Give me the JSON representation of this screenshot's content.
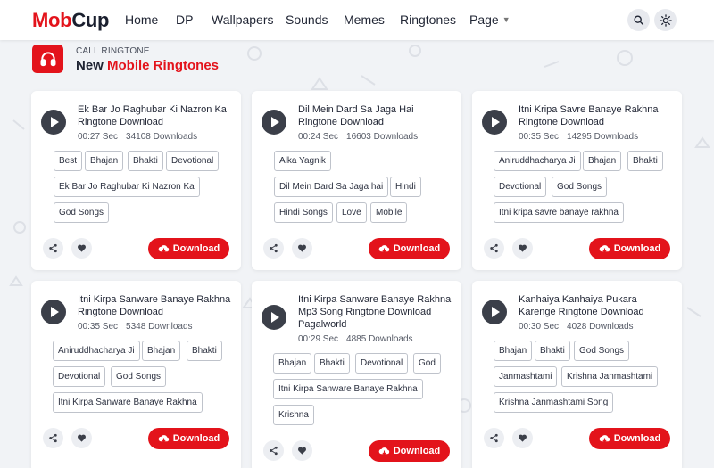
{
  "brand": {
    "part1": "Mob",
    "part2": "Cup"
  },
  "nav": [
    "Home",
    "DP",
    "Wallpapers",
    "Sounds",
    "Memes",
    "Ringtones",
    "Page"
  ],
  "section": {
    "subtitle": "CALL RINGTONE",
    "title_plain": "New ",
    "title_accent": "Mobile Ringtones"
  },
  "download_label": "Download",
  "icons": {
    "search": "search-icon",
    "theme": "sun-icon",
    "header": "headphones-icon",
    "share": "share-icon",
    "like": "heart-icon",
    "download": "cloud-download-icon"
  },
  "colors": {
    "accent": "#e3131b",
    "dark": "#1a1f2e"
  },
  "cards": [
    {
      "title": "Ek Bar Jo Raghubar Ki Nazron Ka Ringtone Download",
      "duration": "00:27 Sec",
      "downloads": "34108 Downloads",
      "tags": [
        "Best",
        "Bhajan",
        "Bhakti",
        "Devotional",
        "Ek Bar Jo Raghubar Ki Nazron Ka",
        "God Songs"
      ]
    },
    {
      "title": "Dil Mein Dard Sa Jaga Hai Ringtone Download",
      "duration": "00:24 Sec",
      "downloads": "16603 Downloads",
      "tags": [
        "Alka Yagnik",
        "Dil Mein Dard Sa Jaga hai",
        "Hindi",
        "Hindi Songs",
        "Love",
        "Mobile"
      ]
    },
    {
      "title": "Itni Kripa Savre Banaye Rakhna Ringtone Download",
      "duration": "00:35 Sec",
      "downloads": "14295 Downloads",
      "tags": [
        "Aniruddhacharya Ji",
        "Bhajan",
        "Bhakti",
        "Devotional",
        "God Songs",
        "Itni kripa savre banaye rakhna"
      ]
    },
    {
      "title": "Itni Kirpa Sanware Banaye Rakhna Ringtone Download",
      "duration": "00:35 Sec",
      "downloads": "5348 Downloads",
      "tags": [
        "Aniruddhacharya Ji",
        "Bhajan",
        "Bhakti",
        "Devotional",
        "God Songs",
        "Itni Kirpa Sanware Banaye Rakhna"
      ]
    },
    {
      "title": "Itni Kirpa Sanware Banaye Rakhna Mp3 Song Ringtone Download Pagalworld",
      "duration": "00:29 Sec",
      "downloads": "4885 Downloads",
      "tags": [
        "Bhajan",
        "Bhakti",
        "Devotional",
        "God",
        "Itni Kirpa Sanware Banaye Rakhna",
        "Krishna"
      ]
    },
    {
      "title": "Kanhaiya Kanhaiya Pukara Karenge Ringtone Download",
      "duration": "00:30 Sec",
      "downloads": "4028 Downloads",
      "tags": [
        "Bhajan",
        "Bhakti",
        "God Songs",
        "Janmashtami",
        "Krishna Janmashtami",
        "Krishna Janmashtami Song"
      ]
    }
  ]
}
